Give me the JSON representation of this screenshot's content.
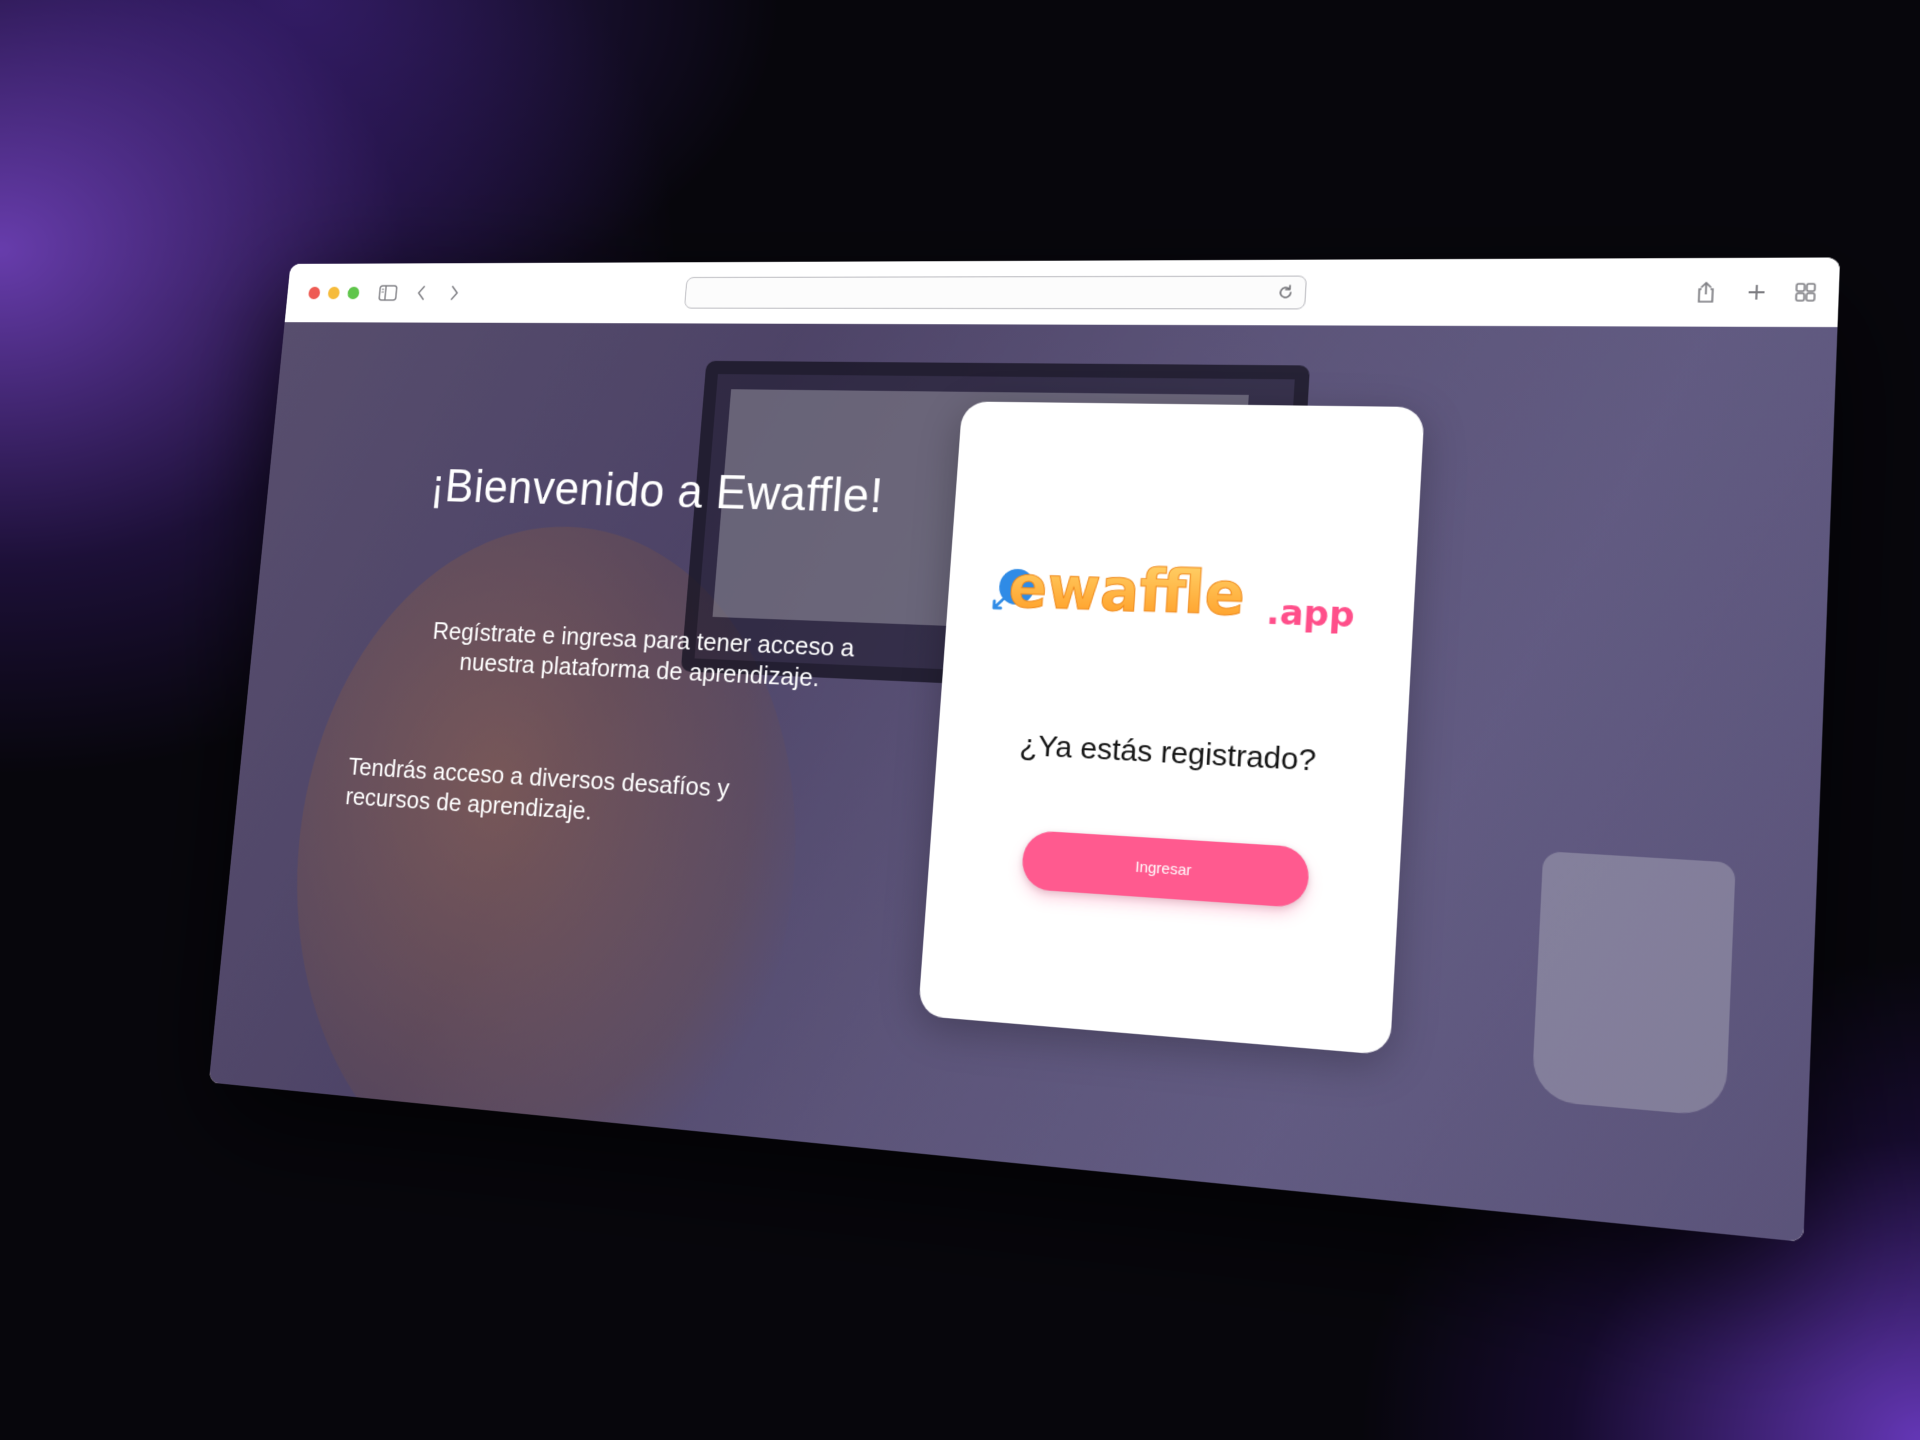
{
  "browser": {
    "url": "",
    "icons": [
      "sidebar-icon",
      "back-icon",
      "forward-icon",
      "reload-icon",
      "share-icon",
      "new-tab-icon",
      "tab-overview-icon"
    ]
  },
  "hero": {
    "title": "¡Bienvenido a Ewaffle!",
    "paragraph1": "Regístrate e ingresa para tener acceso a nuestra plataforma de aprendizaje.",
    "paragraph2": "Tendrás acceso a diversos desafíos y recursos de aprendizaje."
  },
  "card": {
    "logo_main": "ewaffle",
    "logo_suffix": ".app",
    "question": "¿Ya estás registrado?",
    "login_label": "Ingresar"
  },
  "colors": {
    "accent": "#ff5a8f",
    "logo_orange": "#ffaa2b",
    "logo_blue": "#2f8be6",
    "overlay": "#3c3464"
  }
}
